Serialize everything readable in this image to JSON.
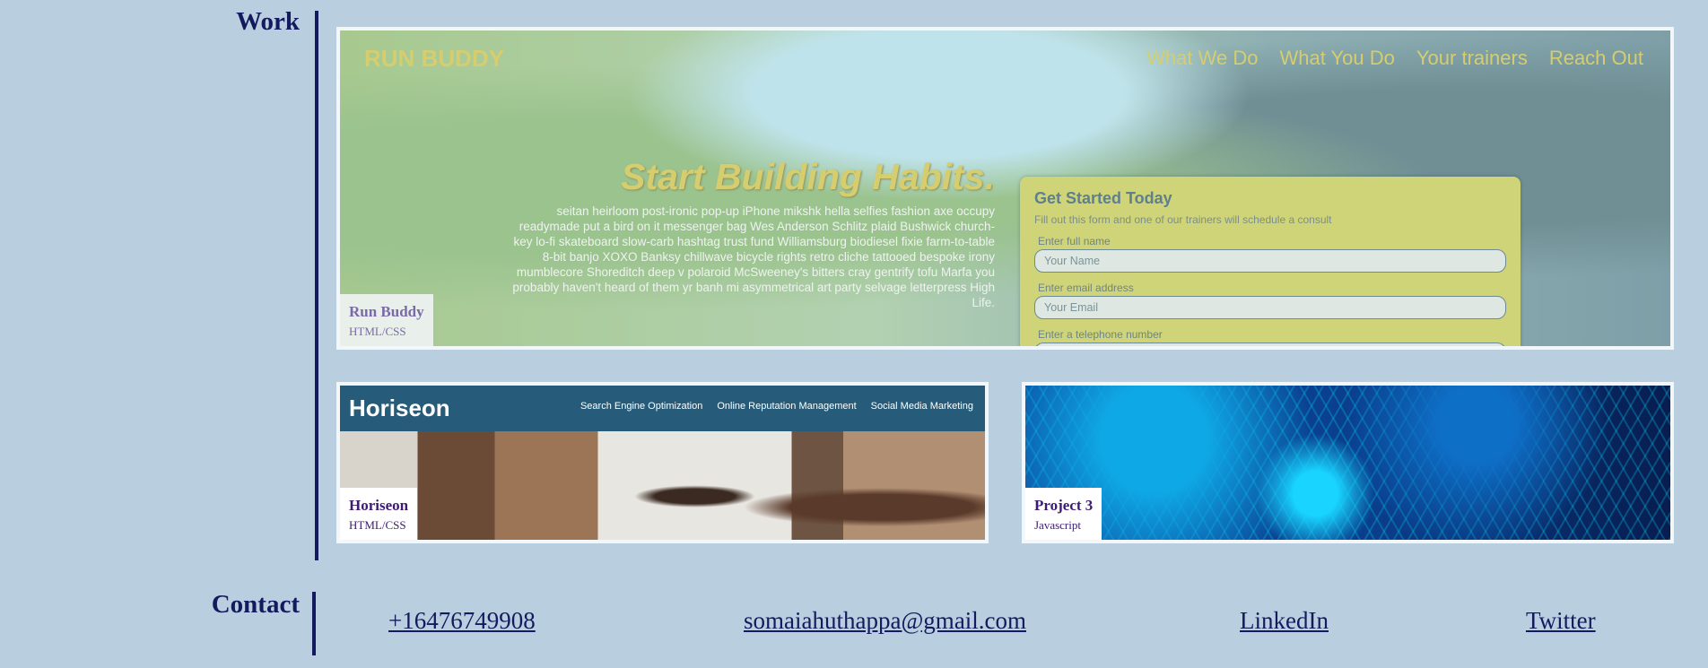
{
  "work": {
    "heading": "Work"
  },
  "projects": [
    {
      "name": "Run Buddy",
      "tech": "HTML/CSS",
      "preview": {
        "title": "RUN BUDDY",
        "nav": [
          "What We Do",
          "What You Do",
          "Your trainers",
          "Reach Out"
        ],
        "hero_heading": "Start Building Habits.",
        "hero_text": "seitan heirloom post-ironic pop-up iPhone mikshk hella selfies fashion axe occupy readymade put a bird on it messenger bag Wes Anderson Schlitz plaid Bushwick church-key lo-fi skateboard slow-carb hashtag trust fund Williamsburg biodiesel fixie farm-to-table 8-bit banjo XOXO Banksy chillwave bicycle rights retro cliche tattooed bespoke irony mumblecore Shoreditch deep v polaroid McSweeney's bitters cray gentrify tofu Marfa you probably haven't heard of them yr banh mi asymmetrical art party selvage letterpress High Life.",
        "form_title": "Get Started Today",
        "form_subtitle": "Fill out this form and one of our trainers will schedule a consult",
        "fields": [
          {
            "label": "Enter full name",
            "placeholder": "Your Name"
          },
          {
            "label": "Enter email address",
            "placeholder": "Your Email"
          },
          {
            "label": "Enter a telephone number",
            "placeholder": ""
          }
        ]
      }
    },
    {
      "name": "Horiseon",
      "tech": "HTML/CSS",
      "preview": {
        "logo": "Horiseon",
        "nav": [
          "Search Engine Optimization",
          "Online Reputation Management",
          "Social Media Marketing"
        ]
      }
    },
    {
      "name": "Project 3",
      "tech": "Javascript"
    }
  ],
  "contact": {
    "heading": "Contact",
    "phone": "+16476749908",
    "email": "somaiahuthappa@gmail.com",
    "linkedin": "LinkedIn",
    "twitter": "Twitter"
  },
  "colors": {
    "background": "#b9cfdf",
    "accent": "#141a5e",
    "caption_text": "#3d1a73"
  }
}
